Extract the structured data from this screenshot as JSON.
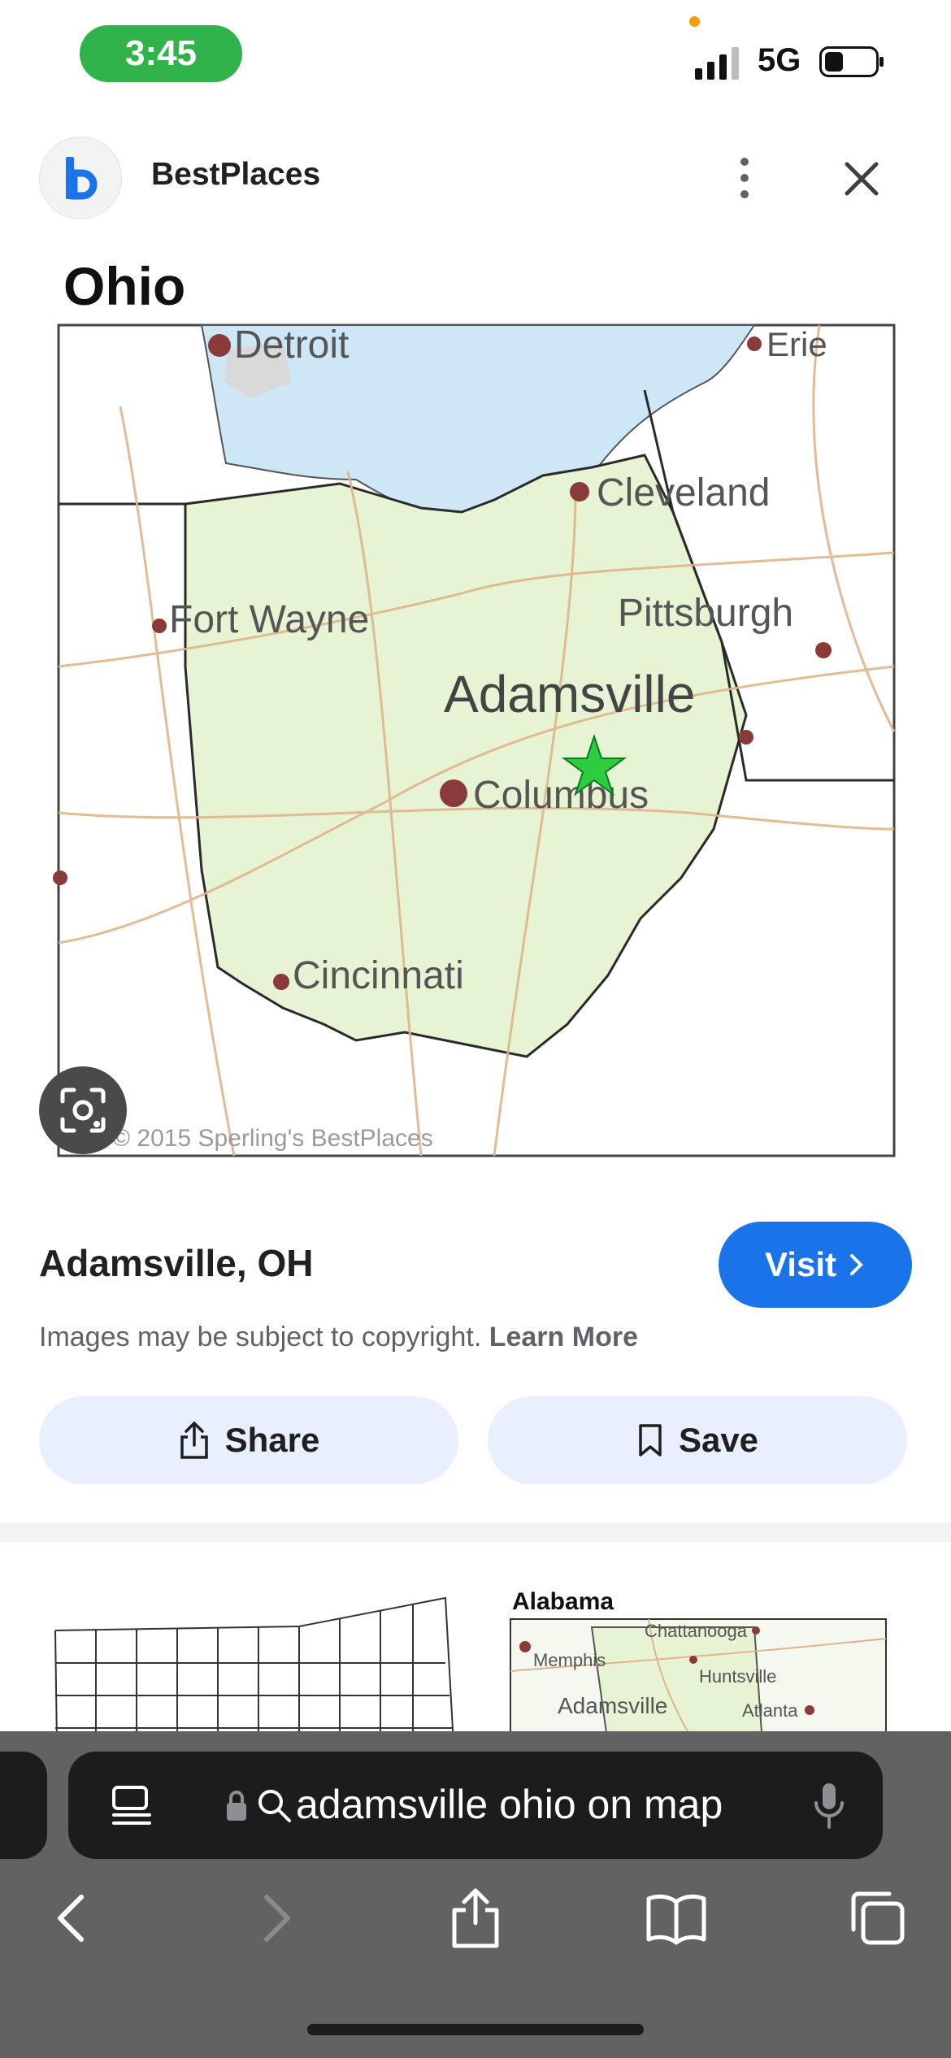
{
  "status_bar": {
    "time": "3:45",
    "network": "5G"
  },
  "header": {
    "site_name": "BestPlaces"
  },
  "image": {
    "map_title": "Ohio",
    "cities": [
      "Detroit",
      "Erie",
      "Cleveland",
      "Fort Wayne",
      "Pittsburgh",
      "Adamsville",
      "Columbus",
      "Cincinnati"
    ],
    "watermark": "© 2015 Sperling's BestPlaces"
  },
  "result": {
    "title": "Adamsville, OH",
    "visit_label": "Visit",
    "copyright_text": "Images may be subject to copyright. ",
    "learn_more": "Learn More",
    "share_label": "Share",
    "save_label": "Save"
  },
  "related": {
    "card2": {
      "title": "Alabama",
      "labels": [
        "Chattanooga",
        "Memphis",
        "Huntsville",
        "Adamsville",
        "Atlanta"
      ]
    }
  },
  "browser": {
    "url_text": "adamsville ohio on map"
  },
  "colors": {
    "accent": "#1a73e8",
    "time_pill": "#2fb34a",
    "ohio_fill": "#e6f4d4",
    "lake": "#cde7f7"
  }
}
